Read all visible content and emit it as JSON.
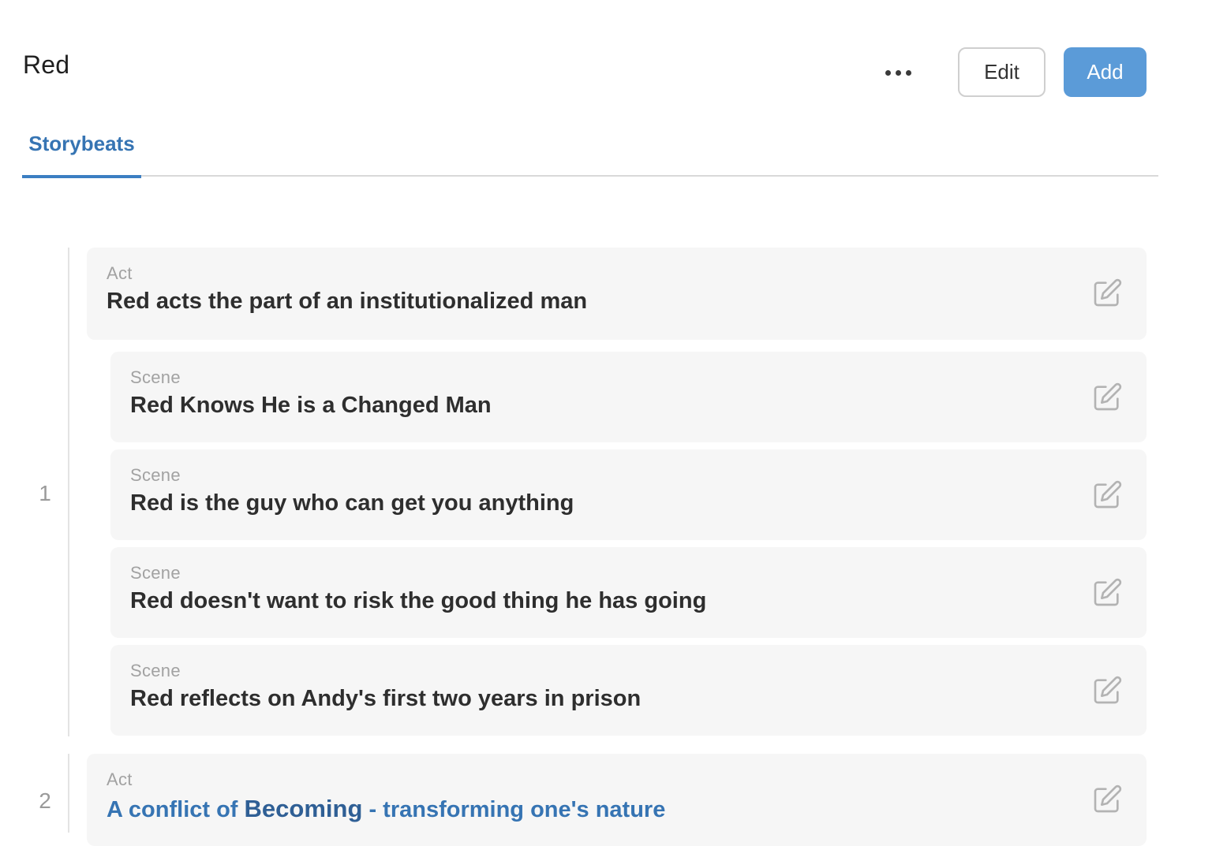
{
  "header": {
    "title": "Red",
    "more_label": "More options",
    "edit_label": "Edit",
    "add_label": "Add"
  },
  "tabs": [
    {
      "label": "Storybeats",
      "active": true
    }
  ],
  "groups": [
    {
      "number": "1",
      "act": {
        "kind": "Act",
        "title": "Red acts the part of an institutionalized man"
      },
      "scenes": [
        {
          "kind": "Scene",
          "title": "Red Knows He is a Changed Man"
        },
        {
          "kind": "Scene",
          "title": "Red is the guy who can get you anything"
        },
        {
          "kind": "Scene",
          "title": "Red doesn't want to risk the good thing he has going"
        },
        {
          "kind": "Scene",
          "title": "Red reflects on Andy's first two years in prison"
        }
      ]
    },
    {
      "number": "2",
      "act": {
        "kind": "Act",
        "title_prefix": "A conflict of",
        "title_emphasis": "Becoming",
        "title_suffix": "- transforming one's nature"
      }
    }
  ],
  "colors": {
    "accent": "#3674b3",
    "primary_button": "#5b9bd8",
    "card_background": "#f6f6f6",
    "muted_text": "#a2a2a2"
  },
  "icons": {
    "more": "ellipsis-icon",
    "edit": "edit-pencil-square-icon"
  }
}
